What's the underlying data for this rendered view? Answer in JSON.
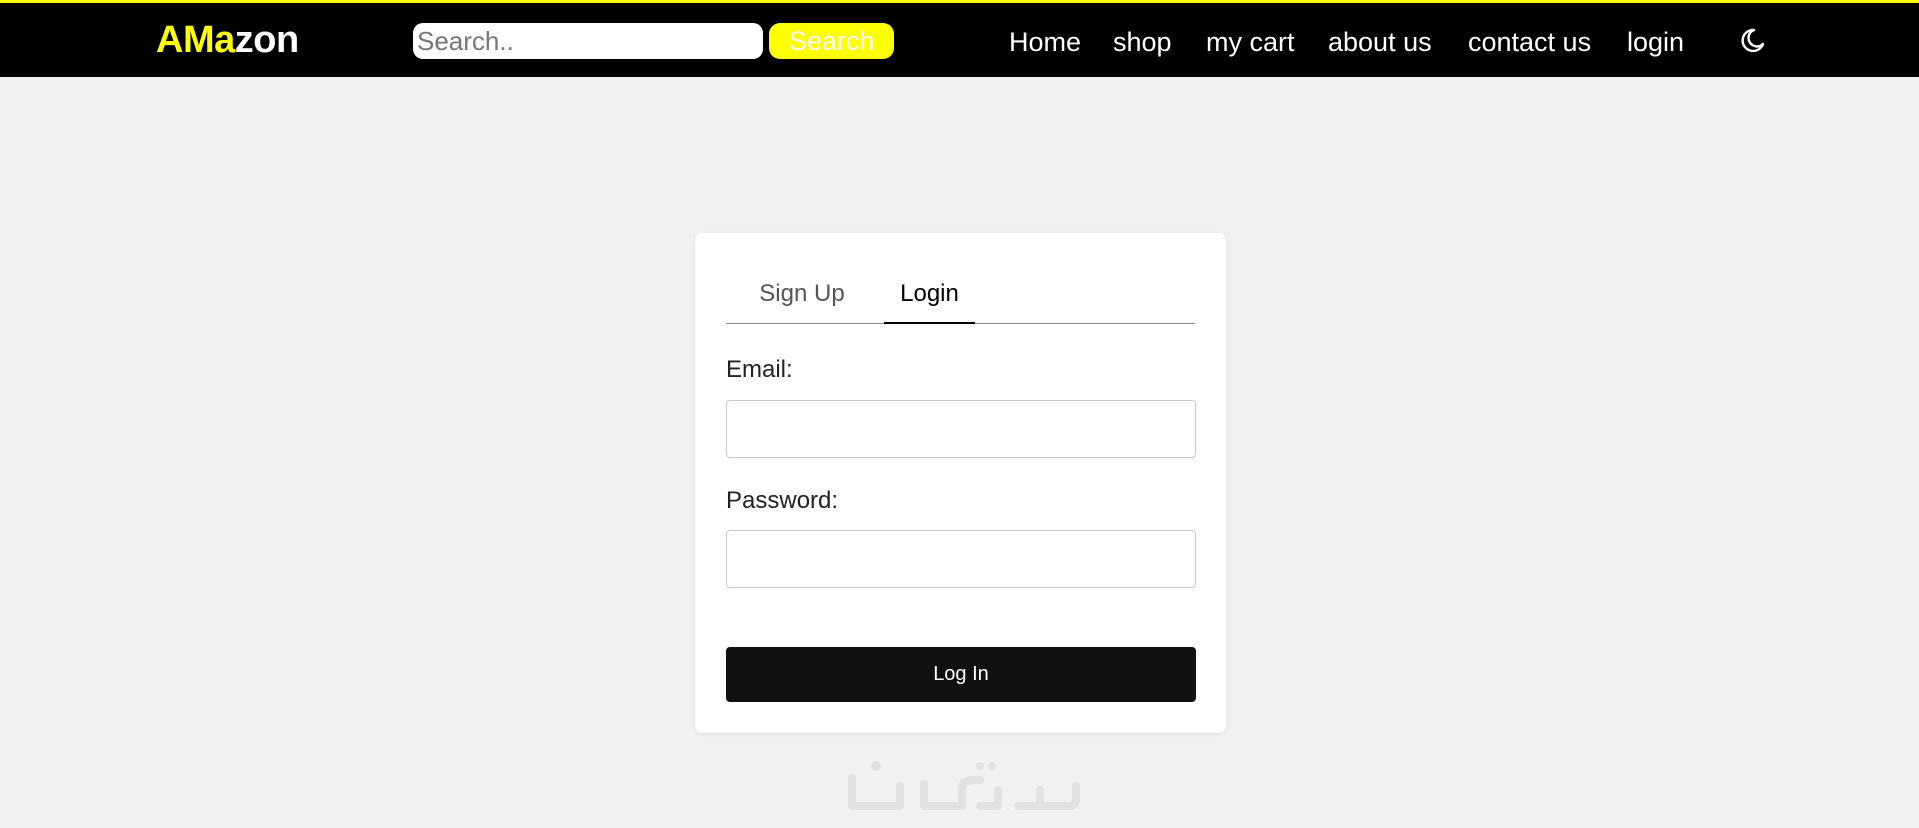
{
  "navbar": {
    "logo": {
      "part1": "AMa",
      "part2": "zon"
    },
    "search": {
      "placeholder": "Search..",
      "value": "",
      "button_label": "Search"
    },
    "links": [
      {
        "label": "Home"
      },
      {
        "label": "shop"
      },
      {
        "label": "my cart"
      },
      {
        "label": "about us"
      },
      {
        "label": "contact us"
      },
      {
        "label": "login"
      }
    ],
    "theme_toggle_icon": "moon-icon"
  },
  "auth_card": {
    "tabs": [
      {
        "label": "Sign Up",
        "active": false
      },
      {
        "label": "Login",
        "active": true
      }
    ],
    "email": {
      "label": "Email:",
      "value": ""
    },
    "password": {
      "label": "Password:",
      "value": ""
    },
    "submit_label": "Log In"
  },
  "watermark": {
    "text": "خمسات"
  },
  "colors": {
    "accent": "#ffff00",
    "navbar_bg": "#000000",
    "page_bg": "#f1f1f1",
    "button_bg": "#111111"
  }
}
